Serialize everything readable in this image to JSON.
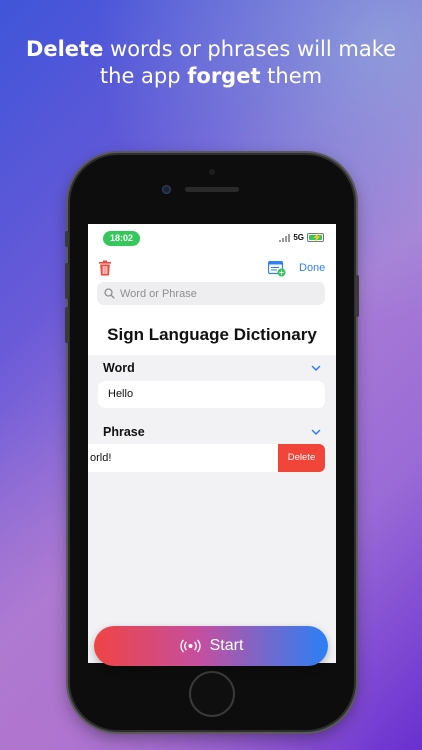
{
  "headline": {
    "line1_bold": "Delete",
    "line1_rest": " words or phrases will make",
    "line2_start": "the app ",
    "line2_bold": "forget",
    "line2_end": " them"
  },
  "status_bar": {
    "time": "18:02",
    "network": "5G"
  },
  "toolbar": {
    "done_label": "Done",
    "trash_icon": "trash-icon",
    "catalog_icon": "catalog-add-icon"
  },
  "search": {
    "placeholder": "Word or Phrase",
    "value": ""
  },
  "page_title": "Sign Language Dictionary",
  "sections": [
    {
      "header": "Word",
      "items": [
        "Hello"
      ]
    },
    {
      "header": "Phrase",
      "items": [
        "orld!"
      ],
      "swipe_action": "Delete"
    }
  ],
  "start_button": {
    "label": "Start",
    "icon": "broadcast-icon"
  },
  "colors": {
    "accent": "#2f7ef6",
    "delete": "#f2453a",
    "status_green": "#34c759"
  }
}
